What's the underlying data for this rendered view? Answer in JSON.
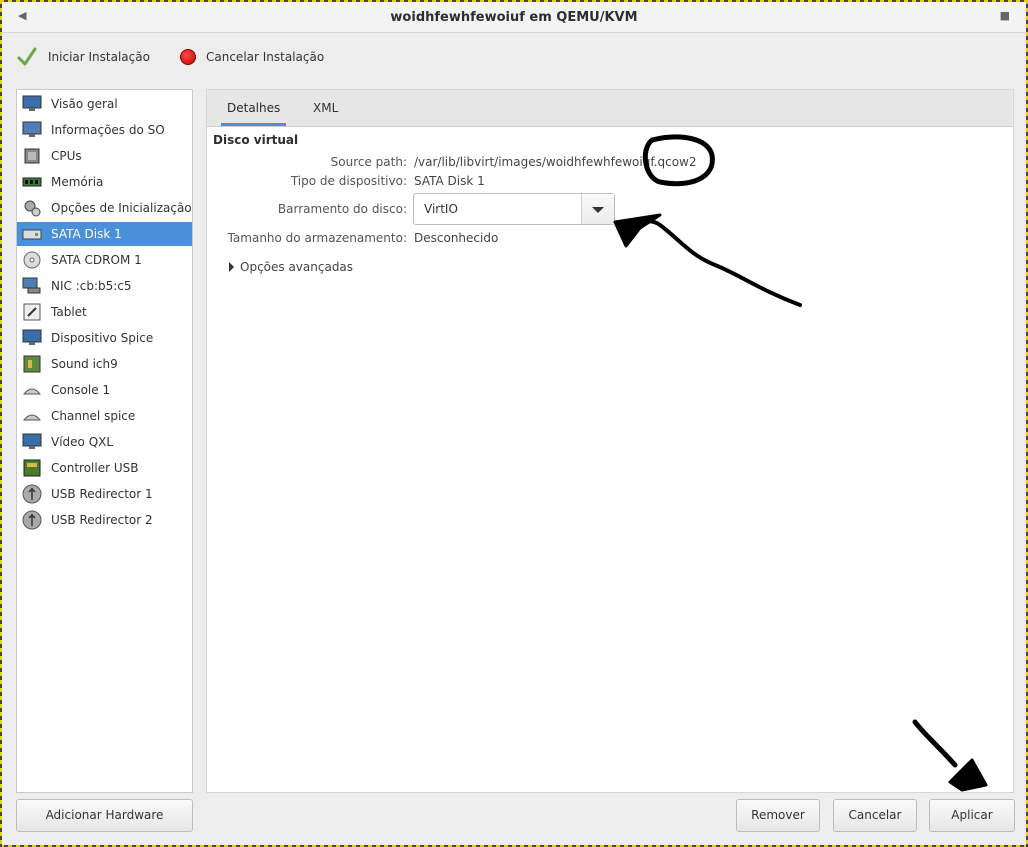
{
  "window": {
    "title": "woidhfewhfewoiuf em QEMU/KVM"
  },
  "toolbar": {
    "start_label": "Iniciar Instalação",
    "cancel_label": "Cancelar Instalação"
  },
  "sidebar": {
    "items": [
      {
        "label": "Visão geral",
        "icon": "monitor-icon"
      },
      {
        "label": "Informações do SO",
        "icon": "os-info-icon"
      },
      {
        "label": "CPUs",
        "icon": "cpu-icon"
      },
      {
        "label": "Memória",
        "icon": "memory-icon"
      },
      {
        "label": "Opções de Inicialização",
        "icon": "boot-options-icon"
      },
      {
        "label": "SATA Disk 1",
        "icon": "disk-icon",
        "selected": true
      },
      {
        "label": "SATA CDROM 1",
        "icon": "cdrom-icon"
      },
      {
        "label": "NIC :cb:b5:c5",
        "icon": "network-icon"
      },
      {
        "label": "Tablet",
        "icon": "tablet-icon"
      },
      {
        "label": "Dispositivo Spice",
        "icon": "spice-display-icon"
      },
      {
        "label": "Sound ich9",
        "icon": "sound-icon"
      },
      {
        "label": "Console 1",
        "icon": "console-icon"
      },
      {
        "label": "Channel spice",
        "icon": "channel-icon"
      },
      {
        "label": "Vídeo QXL",
        "icon": "video-icon"
      },
      {
        "label": "Controller USB",
        "icon": "controller-icon"
      },
      {
        "label": "USB Redirector 1",
        "icon": "usb-icon"
      },
      {
        "label": "USB Redirector 2",
        "icon": "usb-icon"
      }
    ],
    "add_hardware_label": "Adicionar Hardware"
  },
  "tabs": [
    {
      "label": "Detalhes",
      "active": true
    },
    {
      "label": "XML"
    }
  ],
  "details": {
    "section_title": "Disco virtual",
    "source_path_label": "Source path:",
    "source_path_value": "/var/lib/libvirt/images/woidhfewhfewoiuf.qcow2",
    "device_type_label": "Tipo de dispositivo:",
    "device_type_value": "SATA Disk 1",
    "bus_label": "Barramento do disco:",
    "bus_value": "VirtIO",
    "storage_size_label": "Tamanho do armazenamento:",
    "storage_size_value": "Desconhecido",
    "advanced_label": "Opções avançadas"
  },
  "buttons": {
    "remove": "Remover",
    "cancel": "Cancelar",
    "apply": "Aplicar"
  },
  "colors": {
    "selection": "#4a90d9",
    "annotation": "#000000"
  }
}
